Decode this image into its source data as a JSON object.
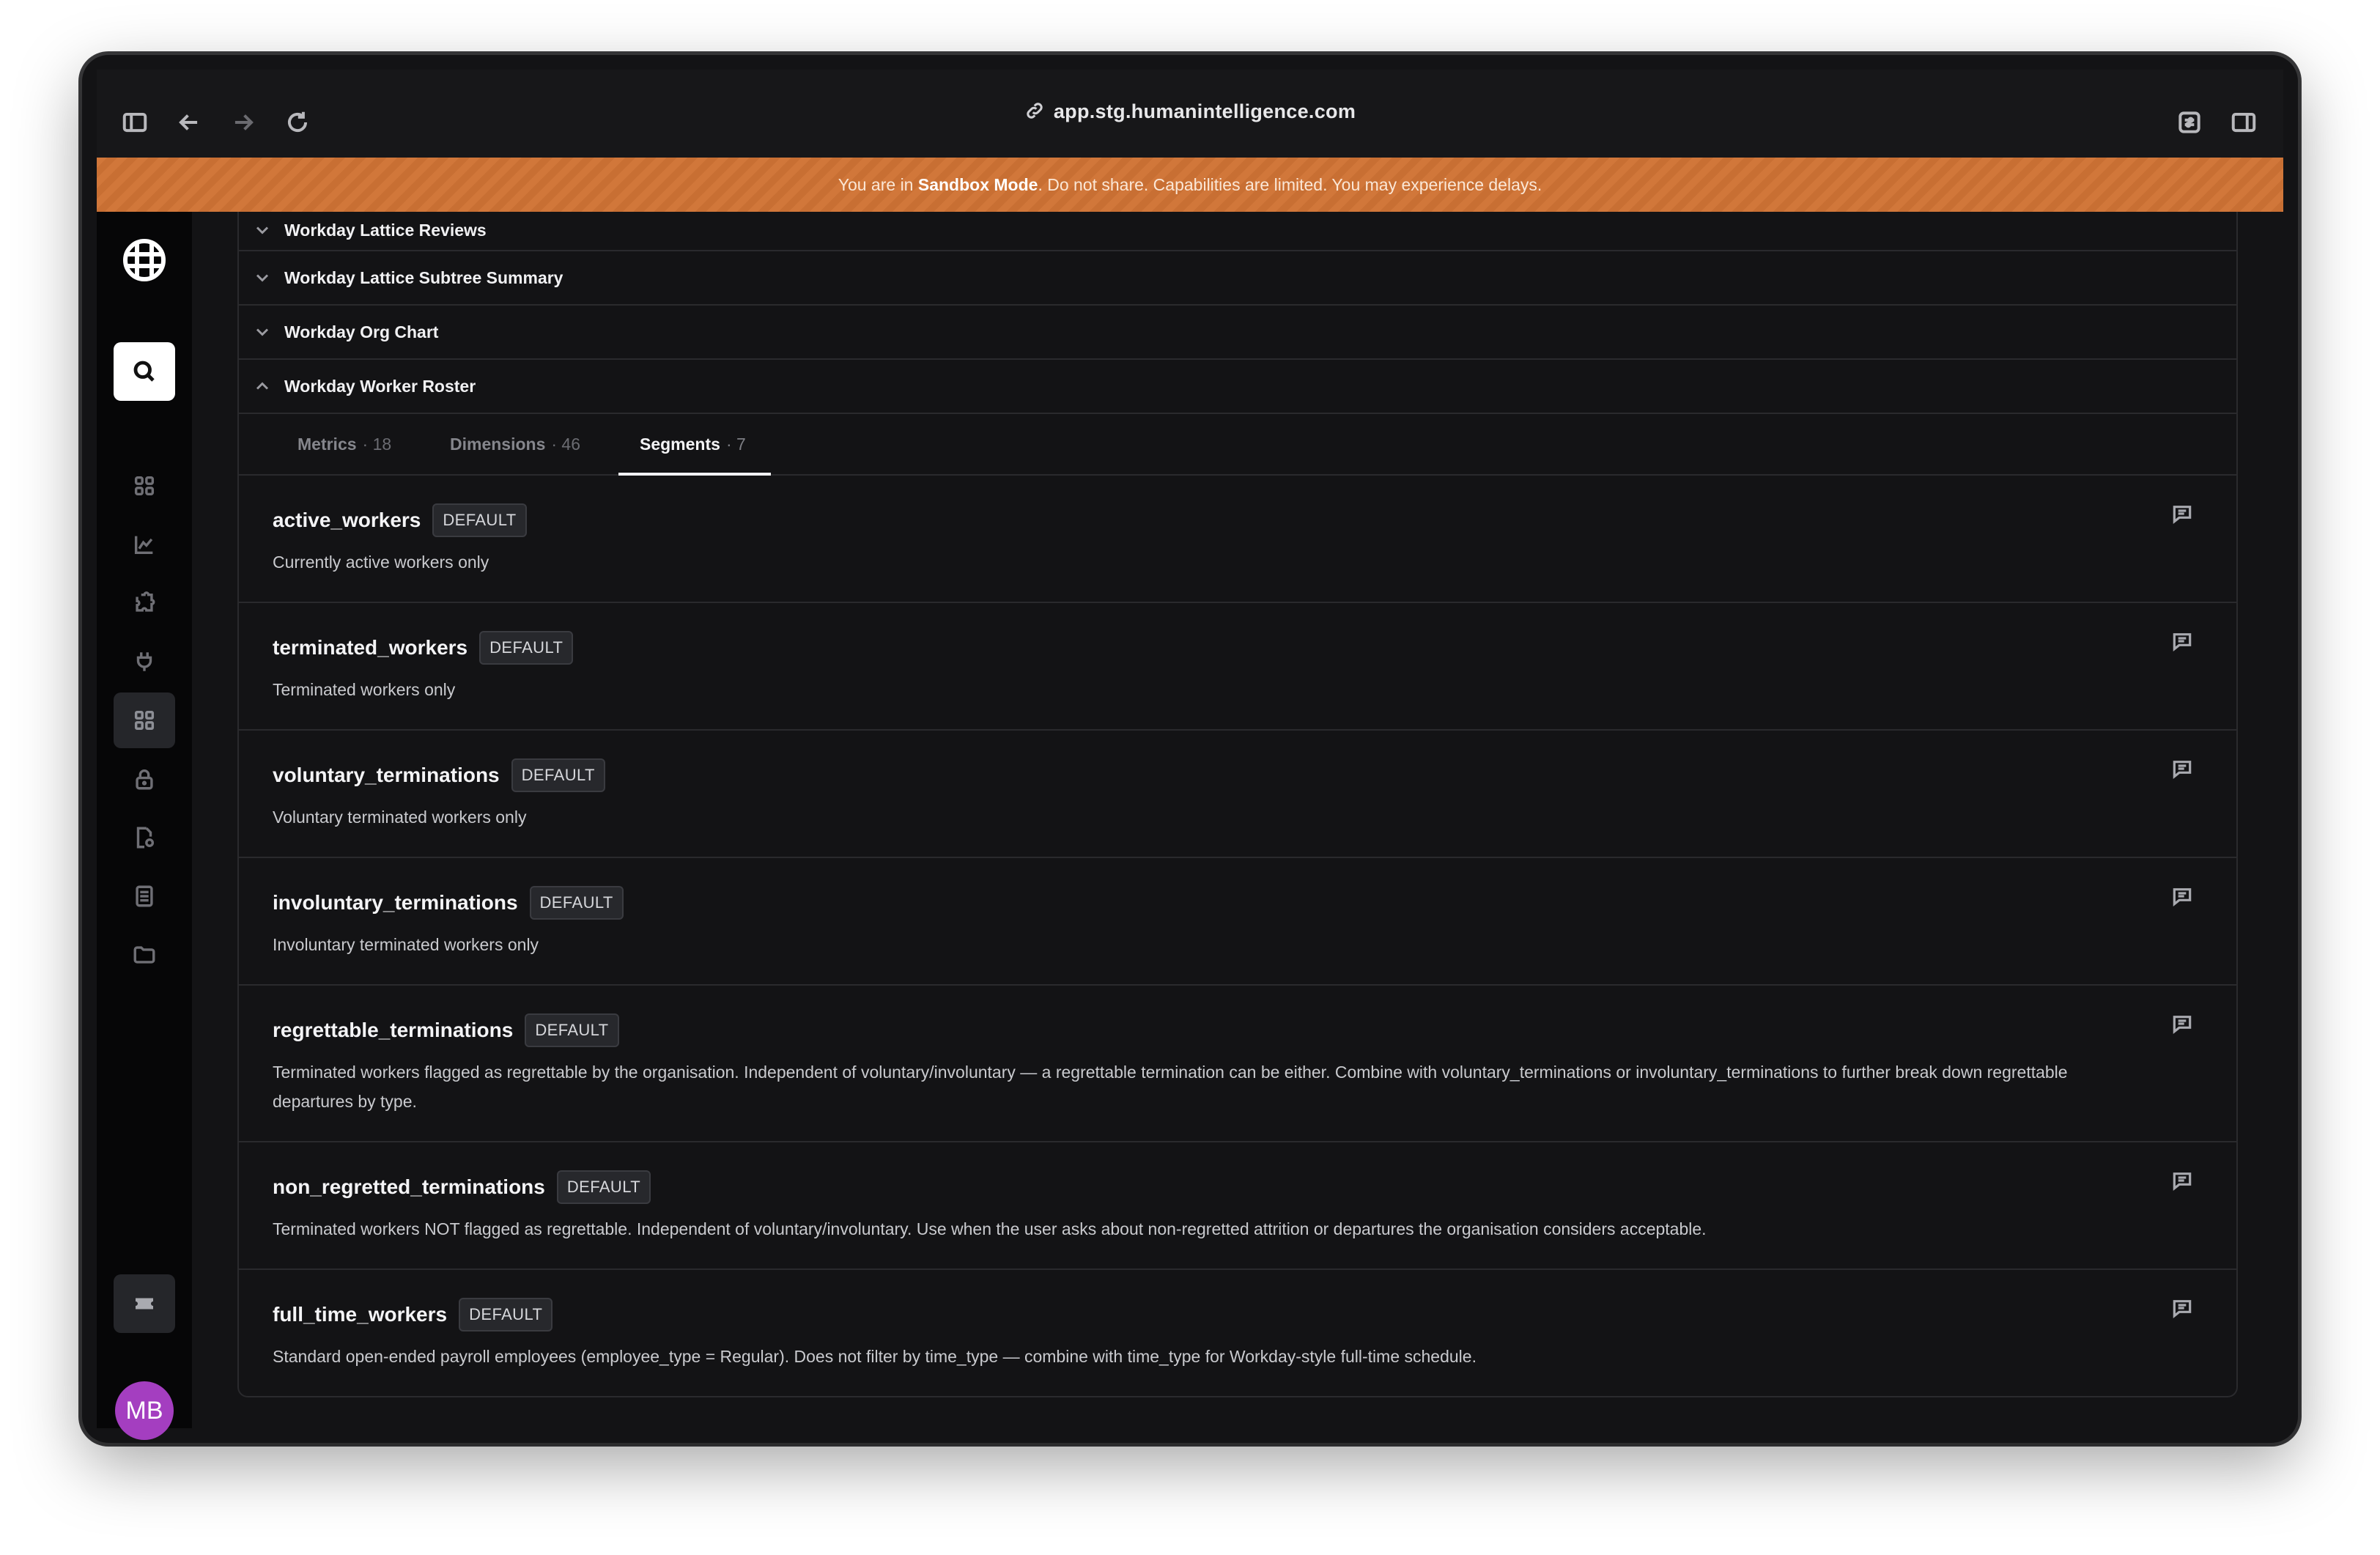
{
  "browser": {
    "url": "app.stg.humanintelligence.com"
  },
  "banner": {
    "prefix": "You are in ",
    "mode": "Sandbox Mode",
    "suffix": ". Do not share. Capabilities are limited. You may experience delays."
  },
  "user": {
    "initials": "MB",
    "avatar_color": "#a43ec0"
  },
  "accordion": [
    {
      "label": "Workday Lattice Reviews",
      "expanded": false
    },
    {
      "label": "Workday Lattice Subtree Summary",
      "expanded": false
    },
    {
      "label": "Workday Org Chart",
      "expanded": false
    },
    {
      "label": "Workday Worker Roster",
      "expanded": true
    }
  ],
  "tabs": [
    {
      "label": "Metrics",
      "count": "· 18"
    },
    {
      "label": "Dimensions",
      "count": "· 46"
    },
    {
      "label": "Segments",
      "count": "· 7"
    }
  ],
  "segments": [
    {
      "name": "active_workers",
      "badge": "DEFAULT",
      "description": "Currently active workers only"
    },
    {
      "name": "terminated_workers",
      "badge": "DEFAULT",
      "description": "Terminated workers only"
    },
    {
      "name": "voluntary_terminations",
      "badge": "DEFAULT",
      "description": "Voluntary terminated workers only"
    },
    {
      "name": "involuntary_terminations",
      "badge": "DEFAULT",
      "description": "Involuntary terminated workers only"
    },
    {
      "name": "regrettable_terminations",
      "badge": "DEFAULT",
      "description": "Terminated workers flagged as regrettable by the organisation. Independent of voluntary/involuntary — a regrettable termination can be either. Combine with voluntary_terminations or involuntary_terminations to further break down regrettable departures by type."
    },
    {
      "name": "non_regretted_terminations",
      "badge": "DEFAULT",
      "description": "Terminated workers NOT flagged as regrettable. Independent of voluntary/involuntary. Use when the user asks about non-regretted attrition or departures the organisation considers acceptable."
    },
    {
      "name": "full_time_workers",
      "badge": "DEFAULT",
      "description": "Standard open-ended payroll employees (employee_type = Regular). Does not filter by time_type — combine with time_type for Workday-style full-time schedule."
    }
  ]
}
